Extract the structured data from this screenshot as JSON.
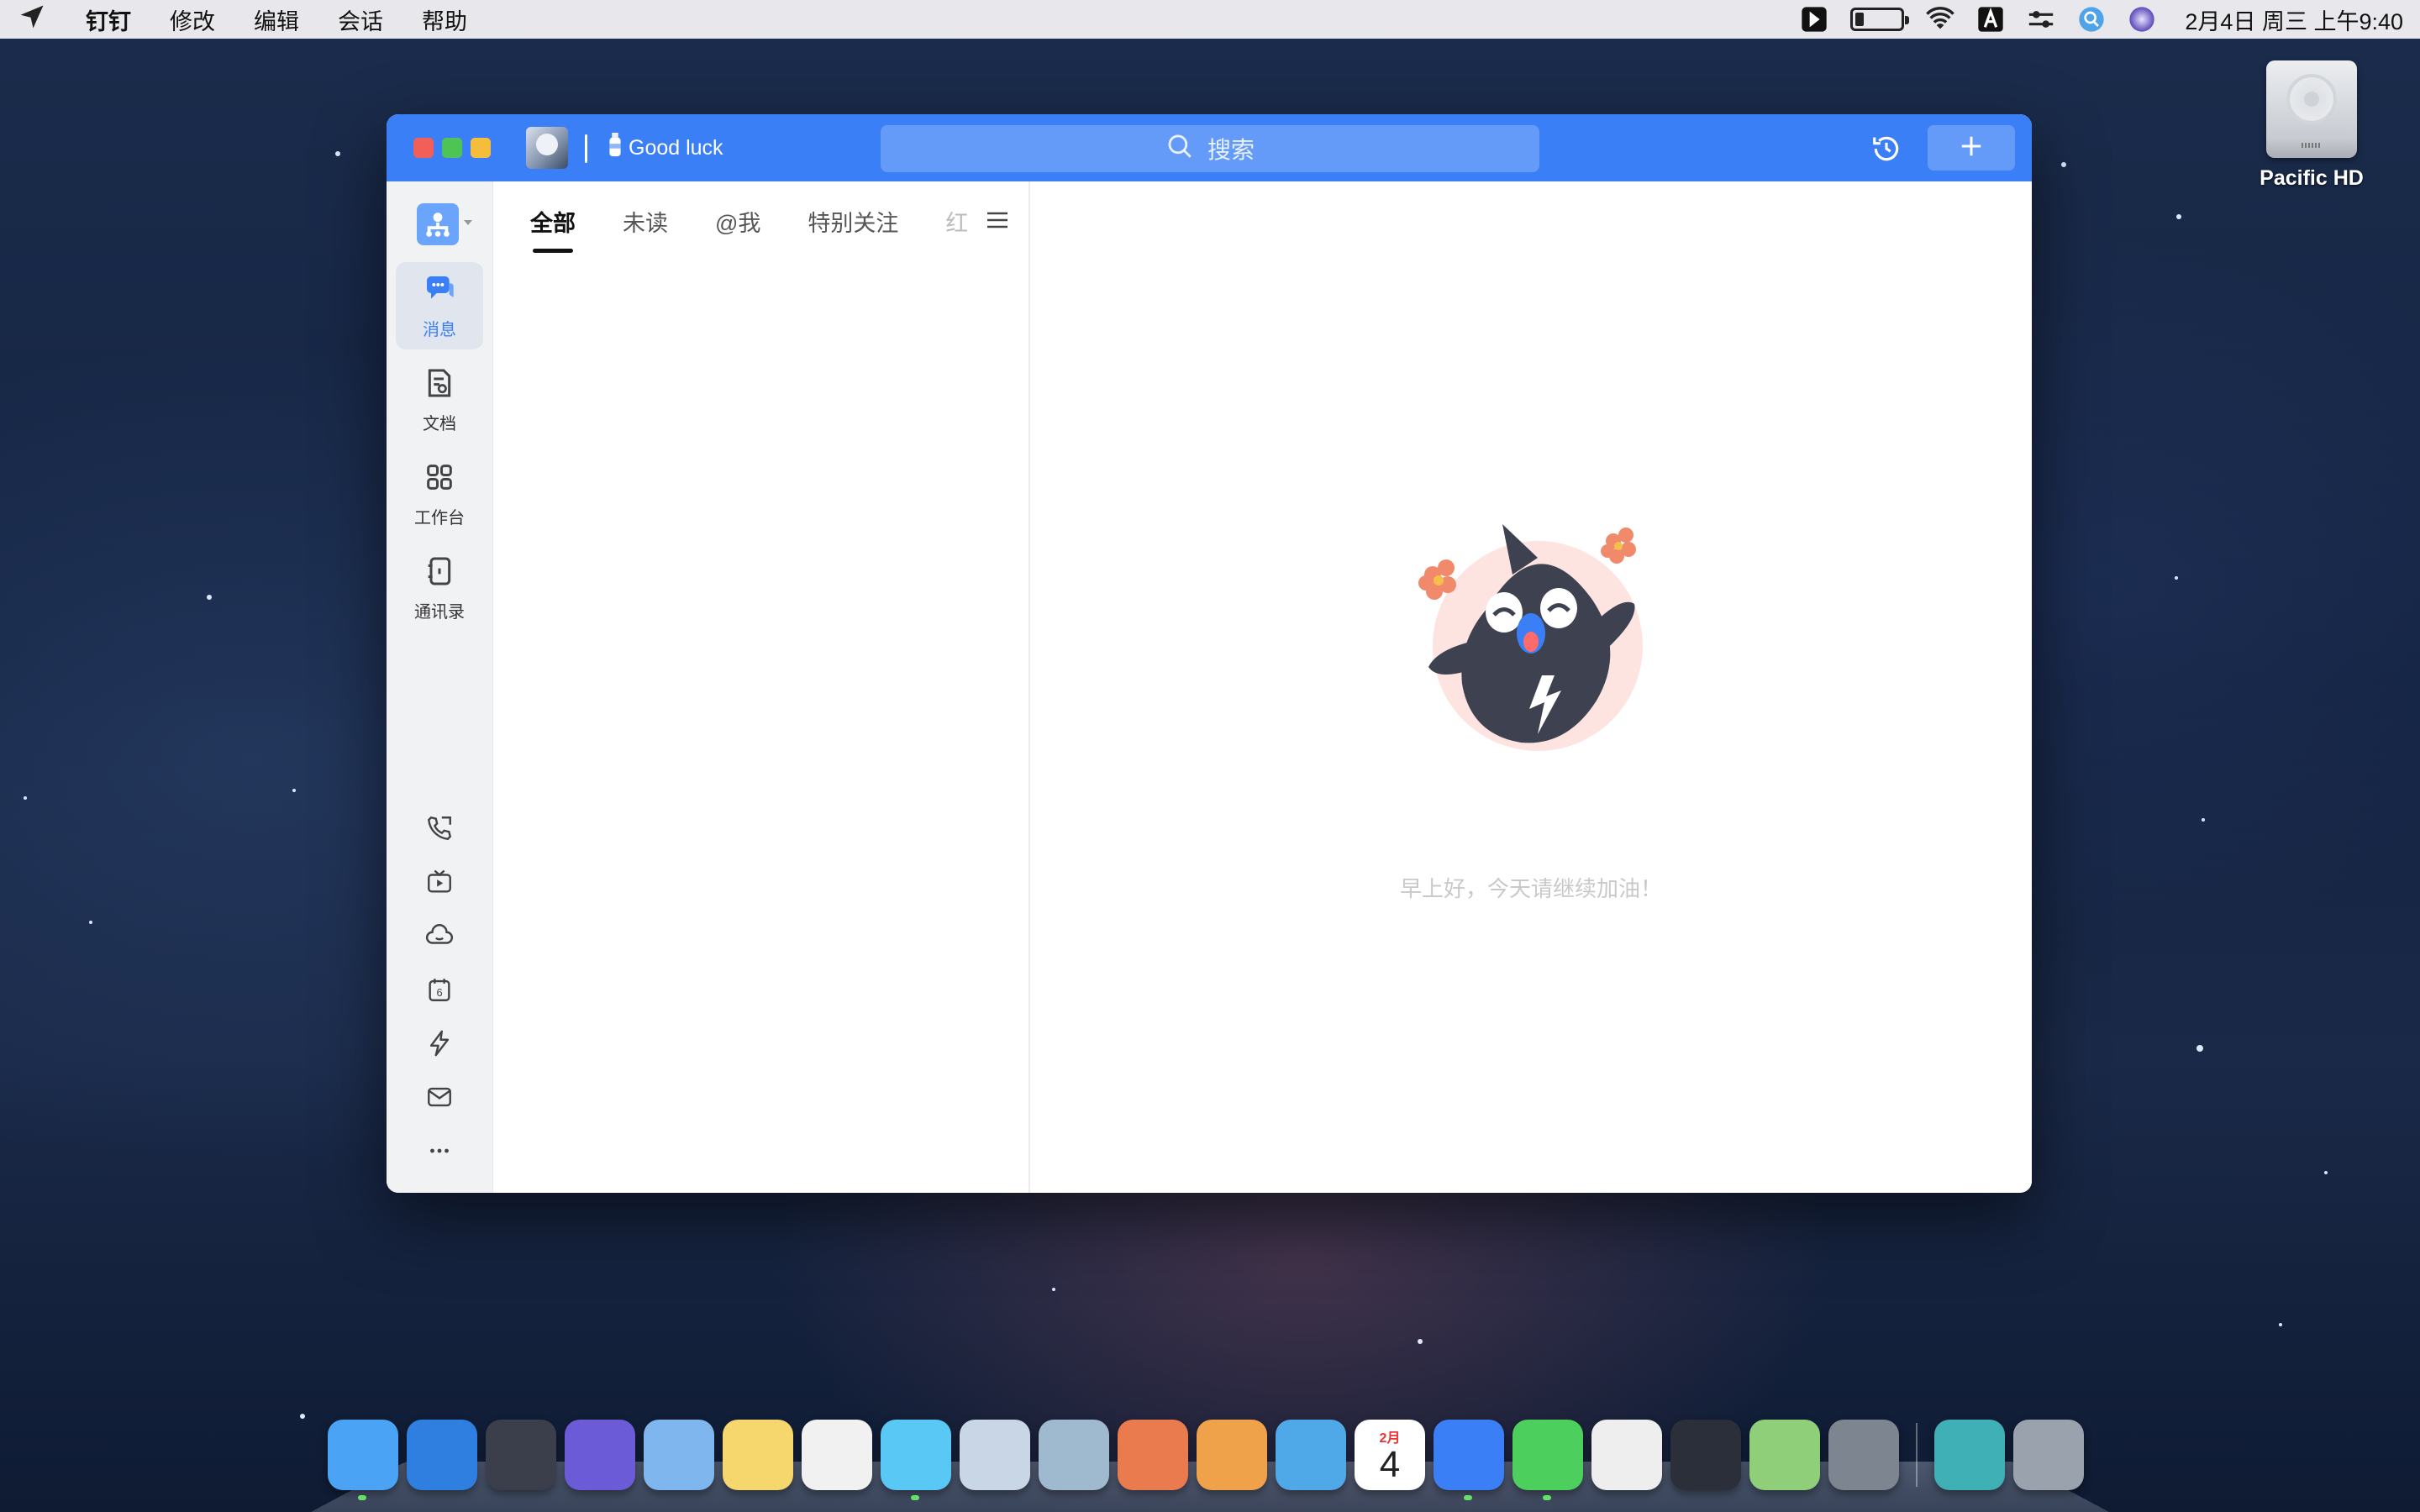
{
  "menubar": {
    "app_name": "钉钉",
    "items": [
      "修改",
      "编辑",
      "会话",
      "帮助"
    ],
    "clock": "2月4日 周三 上午9:40",
    "battery_level": 0.18,
    "tray_icons": [
      "cursor-app-icon",
      "battery-icon",
      "wifi-icon",
      "input-source-icon",
      "control-center-icon",
      "spotlight-icon",
      "siri-icon"
    ]
  },
  "window": {
    "status_text": "Good luck",
    "search_placeholder": "搜索",
    "accent_color": "#3a7ff6"
  },
  "sidebar": {
    "nav": [
      {
        "label": "消息",
        "icon": "message-icon",
        "active": true
      },
      {
        "label": "文档",
        "icon": "document-icon",
        "active": false
      },
      {
        "label": "工作台",
        "icon": "workbench-icon",
        "active": false
      },
      {
        "label": "通讯录",
        "icon": "contacts-icon",
        "active": false
      }
    ],
    "tools": [
      "phone-call-icon",
      "live-tv-icon",
      "ding-cloud-icon",
      "calendar-icon",
      "lightning-icon",
      "mail-icon",
      "more-icon"
    ],
    "calendar_day": "6"
  },
  "convlist": {
    "tabs": [
      "全部",
      "未读",
      "@我",
      "特别关注",
      "红"
    ],
    "active_tab": "全部"
  },
  "main": {
    "greeting": "早上好，今天请继续加油！"
  },
  "desktop": {
    "drive_label": "Pacific HD"
  },
  "dock": {
    "apps": [
      {
        "name": "finder-icon",
        "color": "#4aa3f5"
      },
      {
        "name": "safari-icon",
        "color": "#2f7fe0"
      },
      {
        "name": "launchpad-icon",
        "color": "#3a3f4b"
      },
      {
        "name": "siri-icon",
        "color": "#6b5bd6"
      },
      {
        "name": "mail-icon",
        "color": "#7fb6ee"
      },
      {
        "name": "notes-icon",
        "color": "#f5d76e"
      },
      {
        "name": "reminders-icon",
        "color": "#f1f1f1"
      },
      {
        "name": "messages-icon",
        "color": "#5ac8f5"
      },
      {
        "name": "contacts-icon",
        "color": "#c9d6e5"
      },
      {
        "name": "preview-icon",
        "color": "#9fb9cf"
      },
      {
        "name": "keynote-icon",
        "color": "#e97b4e"
      },
      {
        "name": "pages-icon",
        "color": "#f0a24b"
      },
      {
        "name": "numbers-icon",
        "color": "#4fa9e8"
      },
      {
        "name": "calendar-icon",
        "color": "#ffffff"
      },
      {
        "name": "dingtalk-icon",
        "color": "#3a7ff6"
      },
      {
        "name": "wechat-icon",
        "color": "#4ccf5c"
      },
      {
        "name": "textedit-icon",
        "color": "#eeeeee"
      },
      {
        "name": "quicktime-icon",
        "color": "#2a2f3a"
      },
      {
        "name": "maps-icon",
        "color": "#8fcf7a"
      },
      {
        "name": "system-preferences-icon",
        "color": "#7d8590"
      },
      {
        "name": "downloads-icon",
        "color": "#3fb0b5"
      },
      {
        "name": "trash-icon",
        "color": "#9aa2ad"
      }
    ],
    "calendar_month": "2月",
    "calendar_date": "4"
  }
}
